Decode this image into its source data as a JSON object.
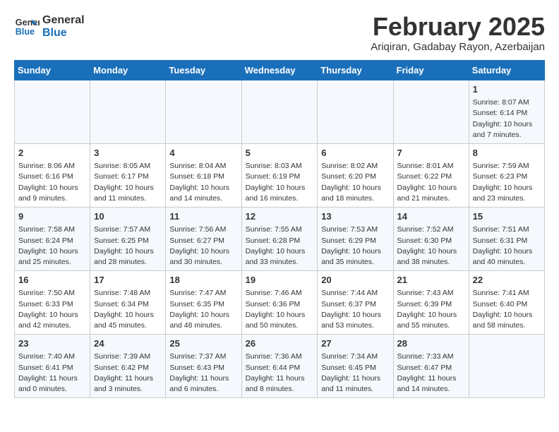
{
  "logo": {
    "line1": "General",
    "line2": "Blue"
  },
  "title": "February 2025",
  "location": "Ariqiran, Gadabay Rayon, Azerbaijan",
  "weekdays": [
    "Sunday",
    "Monday",
    "Tuesday",
    "Wednesday",
    "Thursday",
    "Friday",
    "Saturday"
  ],
  "weeks": [
    [
      {
        "day": "",
        "info": ""
      },
      {
        "day": "",
        "info": ""
      },
      {
        "day": "",
        "info": ""
      },
      {
        "day": "",
        "info": ""
      },
      {
        "day": "",
        "info": ""
      },
      {
        "day": "",
        "info": ""
      },
      {
        "day": "1",
        "info": "Sunrise: 8:07 AM\nSunset: 6:14 PM\nDaylight: 10 hours\nand 7 minutes."
      }
    ],
    [
      {
        "day": "2",
        "info": "Sunrise: 8:06 AM\nSunset: 6:16 PM\nDaylight: 10 hours\nand 9 minutes."
      },
      {
        "day": "3",
        "info": "Sunrise: 8:05 AM\nSunset: 6:17 PM\nDaylight: 10 hours\nand 11 minutes."
      },
      {
        "day": "4",
        "info": "Sunrise: 8:04 AM\nSunset: 6:18 PM\nDaylight: 10 hours\nand 14 minutes."
      },
      {
        "day": "5",
        "info": "Sunrise: 8:03 AM\nSunset: 6:19 PM\nDaylight: 10 hours\nand 16 minutes."
      },
      {
        "day": "6",
        "info": "Sunrise: 8:02 AM\nSunset: 6:20 PM\nDaylight: 10 hours\nand 18 minutes."
      },
      {
        "day": "7",
        "info": "Sunrise: 8:01 AM\nSunset: 6:22 PM\nDaylight: 10 hours\nand 21 minutes."
      },
      {
        "day": "8",
        "info": "Sunrise: 7:59 AM\nSunset: 6:23 PM\nDaylight: 10 hours\nand 23 minutes."
      }
    ],
    [
      {
        "day": "9",
        "info": "Sunrise: 7:58 AM\nSunset: 6:24 PM\nDaylight: 10 hours\nand 25 minutes."
      },
      {
        "day": "10",
        "info": "Sunrise: 7:57 AM\nSunset: 6:25 PM\nDaylight: 10 hours\nand 28 minutes."
      },
      {
        "day": "11",
        "info": "Sunrise: 7:56 AM\nSunset: 6:27 PM\nDaylight: 10 hours\nand 30 minutes."
      },
      {
        "day": "12",
        "info": "Sunrise: 7:55 AM\nSunset: 6:28 PM\nDaylight: 10 hours\nand 33 minutes."
      },
      {
        "day": "13",
        "info": "Sunrise: 7:53 AM\nSunset: 6:29 PM\nDaylight: 10 hours\nand 35 minutes."
      },
      {
        "day": "14",
        "info": "Sunrise: 7:52 AM\nSunset: 6:30 PM\nDaylight: 10 hours\nand 38 minutes."
      },
      {
        "day": "15",
        "info": "Sunrise: 7:51 AM\nSunset: 6:31 PM\nDaylight: 10 hours\nand 40 minutes."
      }
    ],
    [
      {
        "day": "16",
        "info": "Sunrise: 7:50 AM\nSunset: 6:33 PM\nDaylight: 10 hours\nand 42 minutes."
      },
      {
        "day": "17",
        "info": "Sunrise: 7:48 AM\nSunset: 6:34 PM\nDaylight: 10 hours\nand 45 minutes."
      },
      {
        "day": "18",
        "info": "Sunrise: 7:47 AM\nSunset: 6:35 PM\nDaylight: 10 hours\nand 48 minutes."
      },
      {
        "day": "19",
        "info": "Sunrise: 7:46 AM\nSunset: 6:36 PM\nDaylight: 10 hours\nand 50 minutes."
      },
      {
        "day": "20",
        "info": "Sunrise: 7:44 AM\nSunset: 6:37 PM\nDaylight: 10 hours\nand 53 minutes."
      },
      {
        "day": "21",
        "info": "Sunrise: 7:43 AM\nSunset: 6:39 PM\nDaylight: 10 hours\nand 55 minutes."
      },
      {
        "day": "22",
        "info": "Sunrise: 7:41 AM\nSunset: 6:40 PM\nDaylight: 10 hours\nand 58 minutes."
      }
    ],
    [
      {
        "day": "23",
        "info": "Sunrise: 7:40 AM\nSunset: 6:41 PM\nDaylight: 11 hours\nand 0 minutes."
      },
      {
        "day": "24",
        "info": "Sunrise: 7:39 AM\nSunset: 6:42 PM\nDaylight: 11 hours\nand 3 minutes."
      },
      {
        "day": "25",
        "info": "Sunrise: 7:37 AM\nSunset: 6:43 PM\nDaylight: 11 hours\nand 6 minutes."
      },
      {
        "day": "26",
        "info": "Sunrise: 7:36 AM\nSunset: 6:44 PM\nDaylight: 11 hours\nand 8 minutes."
      },
      {
        "day": "27",
        "info": "Sunrise: 7:34 AM\nSunset: 6:45 PM\nDaylight: 11 hours\nand 11 minutes."
      },
      {
        "day": "28",
        "info": "Sunrise: 7:33 AM\nSunset: 6:47 PM\nDaylight: 11 hours\nand 14 minutes."
      },
      {
        "day": "",
        "info": ""
      }
    ]
  ]
}
